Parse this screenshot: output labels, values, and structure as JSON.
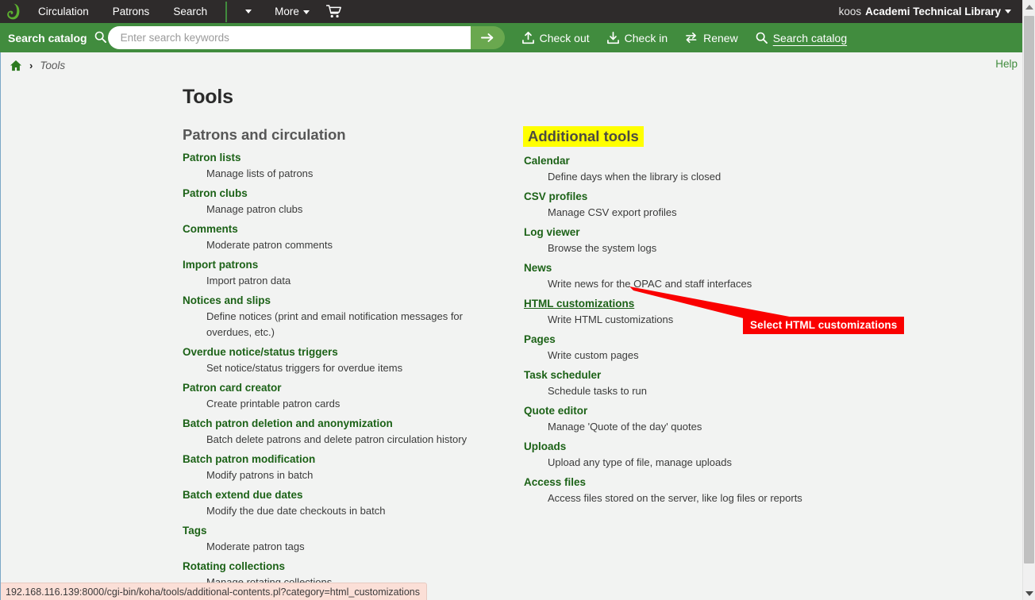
{
  "browser": {
    "status_url": "192.168.116.139:8000/cgi-bin/koha/tools/additional-contents.pl?category=html_customizations"
  },
  "navbar": {
    "logo_name": "koha-leaf-logo",
    "items": [
      {
        "label": "Circulation"
      },
      {
        "label": "Patrons"
      },
      {
        "label": "Search"
      }
    ],
    "more_label": "More",
    "cart_icon": "shopping-cart-icon",
    "user_name": "koos",
    "library_name": "Academi Technical Library"
  },
  "searchbar": {
    "tab_label": "Search catalog",
    "tab_icon": "magnifier-icon",
    "placeholder": "Enter search keywords",
    "value": "",
    "submit_icon": "arrow-right-icon",
    "toolbar": [
      {
        "label": "Check out",
        "icon": "upload-arrow-icon",
        "active": false
      },
      {
        "label": "Check in",
        "icon": "download-arrow-icon",
        "active": false
      },
      {
        "label": "Renew",
        "icon": "exchange-arrows-icon",
        "active": false
      },
      {
        "label": "Search catalog",
        "icon": "magnifier-icon",
        "active": true
      }
    ]
  },
  "breadcrumb": {
    "home_icon": "home-icon",
    "separator": "›",
    "current": "Tools"
  },
  "help_label": "Help",
  "page_title": "Tools",
  "columns": {
    "left": {
      "heading": "Patrons and circulation",
      "highlighted": false,
      "entries": [
        {
          "title": "Patron lists",
          "desc": "Manage lists of patrons"
        },
        {
          "title": "Patron clubs",
          "desc": "Manage patron clubs"
        },
        {
          "title": "Comments",
          "desc": "Moderate patron comments"
        },
        {
          "title": "Import patrons",
          "desc": "Import patron data"
        },
        {
          "title": "Notices and slips",
          "desc": "Define notices (print and email notification messages for overdues, etc.)"
        },
        {
          "title": "Overdue notice/status triggers",
          "desc": "Set notice/status triggers for overdue items"
        },
        {
          "title": "Patron card creator",
          "desc": "Create printable patron cards"
        },
        {
          "title": "Batch patron deletion and anonymization",
          "desc": "Batch delete patrons and delete patron circulation history"
        },
        {
          "title": "Batch patron modification",
          "desc": "Modify patrons in batch"
        },
        {
          "title": "Batch extend due dates",
          "desc": "Modify the due date checkouts in batch"
        },
        {
          "title": "Tags",
          "desc": "Moderate patron tags"
        },
        {
          "title": "Rotating collections",
          "desc": "Manage rotating collections"
        }
      ]
    },
    "right": {
      "heading": "Additional tools",
      "highlighted": true,
      "entries": [
        {
          "title": "Calendar",
          "desc": "Define days when the library is closed"
        },
        {
          "title": "CSV profiles",
          "desc": "Manage CSV export profiles"
        },
        {
          "title": "Log viewer",
          "desc": "Browse the system logs"
        },
        {
          "title": "News",
          "desc": "Write news for the OPAC and staff interfaces"
        },
        {
          "title": "HTML customizations",
          "desc": "Write HTML customizations",
          "hovered": true
        },
        {
          "title": "Pages",
          "desc": "Write custom pages"
        },
        {
          "title": "Task scheduler",
          "desc": "Schedule tasks to run"
        },
        {
          "title": "Quote editor",
          "desc": "Manage 'Quote of the day' quotes"
        },
        {
          "title": "Uploads",
          "desc": "Upload any type of file, manage uploads"
        },
        {
          "title": "Access files",
          "desc": "Access files stored on the server, like log files or reports"
        }
      ]
    }
  },
  "annotation": {
    "callout_text": "Select HTML customizations",
    "callout_color": "#fa0000",
    "arrow_color": "#fa0000"
  },
  "colors": {
    "navbar_bg": "#2e2b2b",
    "green": "#418c3e",
    "green_light": "#6aa84f",
    "link_green": "#1c6217",
    "highlight_yellow": "#ffff00",
    "page_bg": "#f2f3f2",
    "status_bg": "#fbdfd7"
  }
}
